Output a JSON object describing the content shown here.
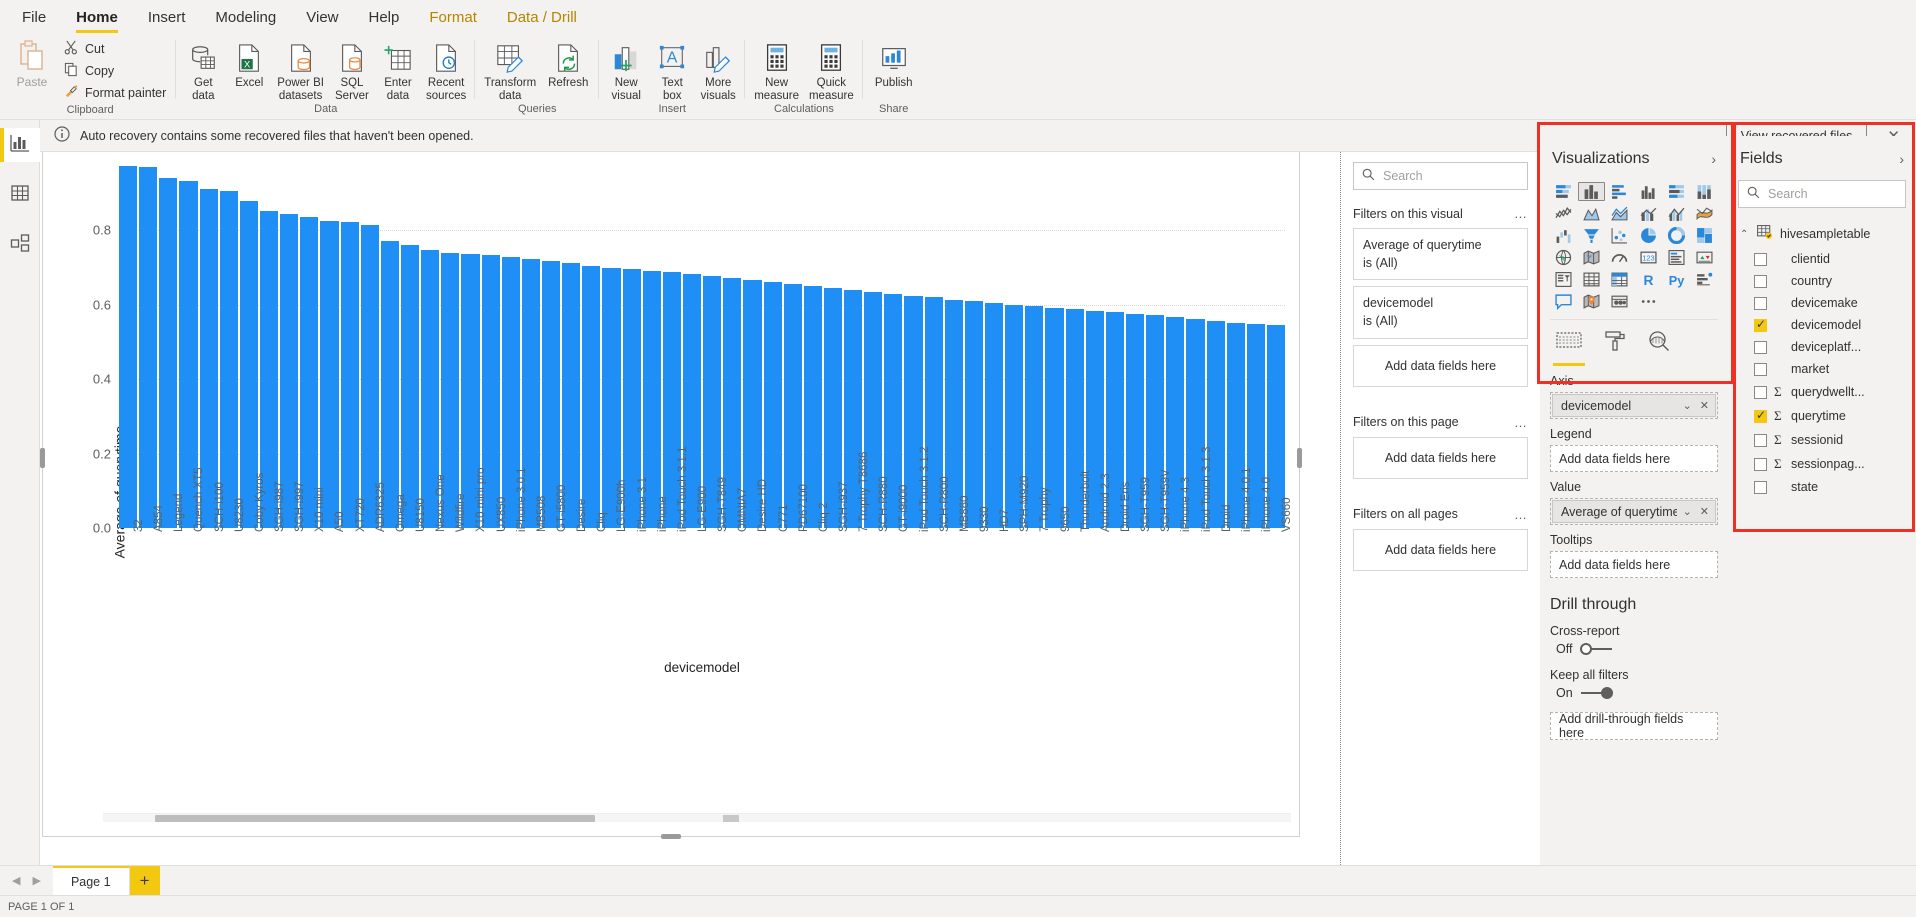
{
  "ribbon": {
    "tabs": [
      {
        "label": "File",
        "state": "normal"
      },
      {
        "label": "Home",
        "state": "active"
      },
      {
        "label": "Insert",
        "state": "normal"
      },
      {
        "label": "Modeling",
        "state": "normal"
      },
      {
        "label": "View",
        "state": "normal"
      },
      {
        "label": "Help",
        "state": "normal"
      },
      {
        "label": "Format",
        "state": "context"
      },
      {
        "label": "Data / Drill",
        "state": "context"
      }
    ],
    "groups": [
      {
        "label": "Clipboard"
      },
      {
        "label": "Data"
      },
      {
        "label": "Queries"
      },
      {
        "label": "Insert"
      },
      {
        "label": "Calculations"
      },
      {
        "label": "Share"
      }
    ],
    "clipboard": {
      "paste": "Paste",
      "cut": "Cut",
      "copy": "Copy",
      "format_painter": "Format painter"
    },
    "data_buttons": [
      {
        "label": "Get\ndata",
        "caret": true
      },
      {
        "label": "Excel",
        "caret": false
      },
      {
        "label": "Power BI\ndatasets",
        "caret": false
      },
      {
        "label": "SQL\nServer",
        "caret": false
      },
      {
        "label": "Enter\ndata",
        "caret": false
      },
      {
        "label": "Recent\nsources",
        "caret": true
      }
    ],
    "queries_buttons": [
      {
        "label": "Transform\ndata",
        "caret": true
      },
      {
        "label": "Refresh",
        "caret": false
      }
    ],
    "insert_buttons": [
      {
        "label": "New\nvisual",
        "caret": false
      },
      {
        "label": "Text\nbox",
        "caret": false
      },
      {
        "label": "More\nvisuals",
        "caret": true
      }
    ],
    "calc_buttons": [
      {
        "label": "New\nmeasure",
        "caret": false
      },
      {
        "label": "Quick\nmeasure",
        "caret": false
      }
    ],
    "share_buttons": [
      {
        "label": "Publish",
        "caret": false
      }
    ]
  },
  "notification": {
    "message": "Auto recovery contains some recovered files that haven't been opened.",
    "button": "View recovered files",
    "close": "✕"
  },
  "leftnav": {
    "items": [
      {
        "name": "report-view",
        "active": true
      },
      {
        "name": "data-view",
        "active": false
      },
      {
        "name": "model-view",
        "active": false
      }
    ]
  },
  "chart_data": {
    "type": "bar",
    "title": "",
    "xlabel": "devicemodel",
    "ylabel": "Average of querytime",
    "ylim": [
      0.0,
      1.0
    ],
    "yticks": [
      "0.0",
      "0.2",
      "0.4",
      "0.6",
      "0.8"
    ],
    "grid": true,
    "legend": "none",
    "bar_color": "#1f8ff5",
    "categories": [
      "32",
      "A854",
      "Legend",
      "Quench XT5",
      "SCH-i100",
      "U8230",
      "Coby Kyros",
      "SGH-i987",
      "SGH-i997",
      "X10 mini",
      "A50",
      "XT720",
      "ADR6325",
      "Omega",
      "U8150",
      "Nexus One",
      "Wildfire",
      "X10 mini pro",
      "UX850",
      "iPhone 3.0.1",
      "MB508",
      "GT-i5800",
      "Desire",
      "Cliq",
      "LG-E900h",
      "iPhone 3.1",
      "iPhone",
      "iPod Touch 3.1.1",
      "LG-E900",
      "SGH-T849",
      "OMNIA7",
      "Desire HD",
      "C771",
      "PD67100",
      "Cliq 2",
      "SGH-i937",
      "7 Trophy T8686",
      "SCH-R880",
      "GT-i9000",
      "iPod Touch 3.1.2",
      "SCH-R800",
      "MB860",
      "9330",
      "HD7",
      "SPH-M920",
      "7 Trophy",
      "9650",
      "Thunderbolt",
      "Android 2.3",
      "Droid Eris",
      "SGH-T959",
      "SGH-T959V",
      "iPhone 4.3",
      "iPod Touch 3.1.3",
      "Droid",
      "iPhone 4.0.1",
      "iPhone 4.0",
      "VS660"
    ],
    "values": [
      0.972,
      0.971,
      0.94,
      0.932,
      0.912,
      0.905,
      0.88,
      0.852,
      0.843,
      0.836,
      0.826,
      0.822,
      0.815,
      0.771,
      0.76,
      0.747,
      0.74,
      0.736,
      0.733,
      0.728,
      0.722,
      0.718,
      0.712,
      0.705,
      0.7,
      0.696,
      0.69,
      0.688,
      0.683,
      0.678,
      0.672,
      0.666,
      0.66,
      0.655,
      0.65,
      0.645,
      0.64,
      0.635,
      0.63,
      0.625,
      0.62,
      0.614,
      0.61,
      0.606,
      0.6,
      0.596,
      0.592,
      0.588,
      0.584,
      0.58,
      0.576,
      0.572,
      0.568,
      0.562,
      0.556,
      0.552,
      0.548,
      0.545
    ]
  },
  "filters_pane": {
    "search_placeholder": "Search",
    "sections": [
      {
        "title": "Filters on this visual",
        "dots": "…",
        "cards": [
          {
            "field": "Average of querytime",
            "condition": "is (All)"
          },
          {
            "field": "devicemodel",
            "condition": "is (All)"
          }
        ],
        "drop": "Add data fields here"
      },
      {
        "title": "Filters on this page",
        "dots": "…",
        "cards": [],
        "drop": "Add data fields here"
      },
      {
        "title": "Filters on all pages",
        "dots": "…",
        "cards": [],
        "drop": "Add data fields here"
      }
    ]
  },
  "visualizations_pane": {
    "title": "Visualizations",
    "chevron": "›",
    "icons": [
      "stacked-bar-chart-icon",
      "stacked-column-chart-icon",
      "clustered-bar-chart-icon",
      "clustered-column-chart-icon",
      "100-stacked-bar-chart-icon",
      "100-stacked-column-chart-icon",
      "line-chart-icon",
      "area-chart-icon",
      "stacked-area-chart-icon",
      "line-stacked-column-chart-icon",
      "line-clustered-column-chart-icon",
      "ribbon-chart-icon",
      "waterfall-chart-icon",
      "funnel-chart-icon",
      "scatter-chart-icon",
      "pie-chart-icon",
      "donut-chart-icon",
      "treemap-icon",
      "map-icon",
      "filled-map-icon",
      "gauge-icon",
      "card-icon",
      "multi-row-card-icon",
      "kpi-icon",
      "slicer-icon",
      "table-icon",
      "matrix-icon",
      "r-script-visual-icon",
      "python-visual-icon",
      "key-influencers-icon",
      "smart-narrative-icon",
      "arcgis-map-icon",
      "paginated-report-icon",
      "more-options-icon"
    ],
    "selected_icon_index": 1,
    "tabs": [
      {
        "name": "fields-tab",
        "active": true
      },
      {
        "name": "format-tab",
        "active": false
      },
      {
        "name": "analytics-tab",
        "active": false
      }
    ],
    "wells": [
      {
        "label": "Axis",
        "type": "chip",
        "value": "devicemodel"
      },
      {
        "label": "Legend",
        "type": "drop",
        "value": "Add data fields here"
      },
      {
        "label": "Value",
        "type": "chip",
        "value": "Average of querytime"
      },
      {
        "label": "Tooltips",
        "type": "drop",
        "value": "Add data fields here"
      }
    ],
    "drill_through": {
      "title": "Drill through",
      "cross_report_label": "Cross-report",
      "cross_report_state": "Off",
      "keep_filters_label": "Keep all filters",
      "keep_filters_state": "On",
      "drop": "Add drill-through fields here"
    }
  },
  "fields_pane": {
    "title": "Fields",
    "chevron": "›",
    "search_placeholder": "Search",
    "table": {
      "name": "hivesampletable",
      "expanded": true,
      "collapse_glyph": "⌃"
    },
    "fields": [
      {
        "label": "clientid",
        "checked": false,
        "measure": false
      },
      {
        "label": "country",
        "checked": false,
        "measure": false
      },
      {
        "label": "devicemake",
        "checked": false,
        "measure": false
      },
      {
        "label": "devicemodel",
        "checked": true,
        "measure": false
      },
      {
        "label": "deviceplatf...",
        "checked": false,
        "measure": false
      },
      {
        "label": "market",
        "checked": false,
        "measure": false
      },
      {
        "label": "querydwellt...",
        "checked": false,
        "measure": true
      },
      {
        "label": "querytime",
        "checked": true,
        "measure": true
      },
      {
        "label": "sessionid",
        "checked": false,
        "measure": true
      },
      {
        "label": "sessionpag...",
        "checked": false,
        "measure": true
      },
      {
        "label": "state",
        "checked": false,
        "measure": false
      }
    ]
  },
  "pagebar": {
    "prev": "◀",
    "next": "▶",
    "page_tab": "Page 1",
    "add": "+"
  },
  "statusbar": {
    "text": "PAGE 1 OF 1"
  },
  "colors": {
    "accent_yellow": "#f2c811",
    "bar_blue": "#1f8ff5",
    "annotation_red": "#ee3124",
    "ribbon_bg": "#f3f2f1"
  }
}
